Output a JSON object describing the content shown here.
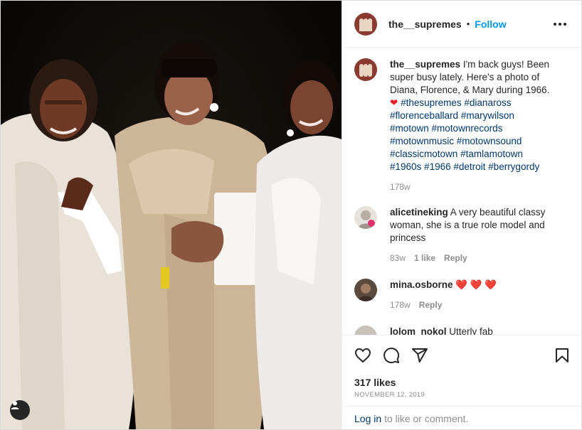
{
  "post": {
    "username": "the__supremes",
    "separator": "•",
    "follow_label": "Follow",
    "caption": {
      "username": "the__supremes",
      "text": "I'm back guys! Been super busy lately. Here's a photo of Diana, Florence, & Mary during 1966.",
      "heart": "❤",
      "hashtags": [
        "#thesupremes",
        "#dianaross",
        "#florenceballard",
        "#marywilson",
        "#motown",
        "#motownrecords",
        "#motownmusic",
        "#motownsound",
        "#classicmotown",
        "#tamlamotown",
        "#1960s",
        "#1966",
        "#detroit",
        "#berrygordy"
      ],
      "time": "178w"
    },
    "comments": [
      {
        "username": "alicetineking",
        "text": "A very beautiful classy woman, she is a true role model and princess",
        "time": "83w",
        "likes": "1 like",
        "reply": "Reply"
      },
      {
        "username": "mina.osborne",
        "text": "❤️ ❤️ ❤️",
        "time": "178w",
        "reply": "Reply"
      },
      {
        "username": "lolom_nokol",
        "text": "Utterly fab"
      }
    ],
    "likes": "317 likes",
    "date": "NOVEMBER 12, 2019",
    "login": {
      "link": "Log in",
      "rest": " to like or comment."
    },
    "icons": [
      "like-heart-icon",
      "comment-icon",
      "share-icon",
      "save-bookmark-icon",
      "more-options-icon",
      "tagged-user-icon"
    ],
    "colors": {
      "accent": "#0095f6",
      "link": "#00376b",
      "heart": "#ed1c24",
      "muted": "#8e8e8e"
    }
  }
}
